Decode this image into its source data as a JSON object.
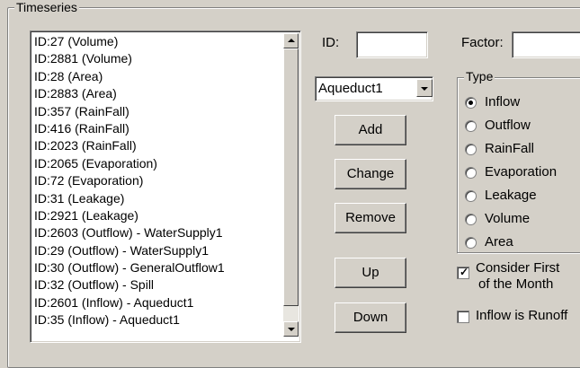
{
  "group_title": "Timeseries",
  "list_items": [
    "ID:27 (Volume)",
    "ID:2881 (Volume)",
    "ID:28 (Area)",
    "ID:2883 (Area)",
    "ID:357 (RainFall)",
    "ID:416 (RainFall)",
    "ID:2023 (RainFall)",
    "ID:2065 (Evaporation)",
    "ID:72 (Evaporation)",
    "ID:31 (Leakage)",
    "ID:2921 (Leakage)",
    "ID:2603 (Outflow) - WaterSupply1",
    "ID:29 (Outflow) - WaterSupply1",
    "ID:30 (Outflow) - GeneralOutflow1",
    "ID:32 (Outflow) - Spill",
    "ID:2601 (Inflow) - Aqueduct1",
    "ID:35 (Inflow) - Aqueduct1"
  ],
  "id_label": "ID:",
  "id_value": "",
  "factor_label": "Factor:",
  "factor_value": "",
  "dropdown": {
    "selected": "Aqueduct1"
  },
  "buttons": {
    "add": "Add",
    "change": "Change",
    "remove": "Remove",
    "up": "Up",
    "down": "Down"
  },
  "type_group": {
    "title": "Type",
    "options": [
      "Inflow",
      "Outflow",
      "RainFall",
      "Evaporation",
      "Leakage",
      "Volume",
      "Area"
    ],
    "selected": "Inflow"
  },
  "checkboxes": {
    "consider_first_line1": "Consider First",
    "consider_first_line2": "of the Month",
    "consider_first_checked": true,
    "inflow_is_runoff": "Inflow is Runoff",
    "inflow_is_runoff_checked": false
  }
}
